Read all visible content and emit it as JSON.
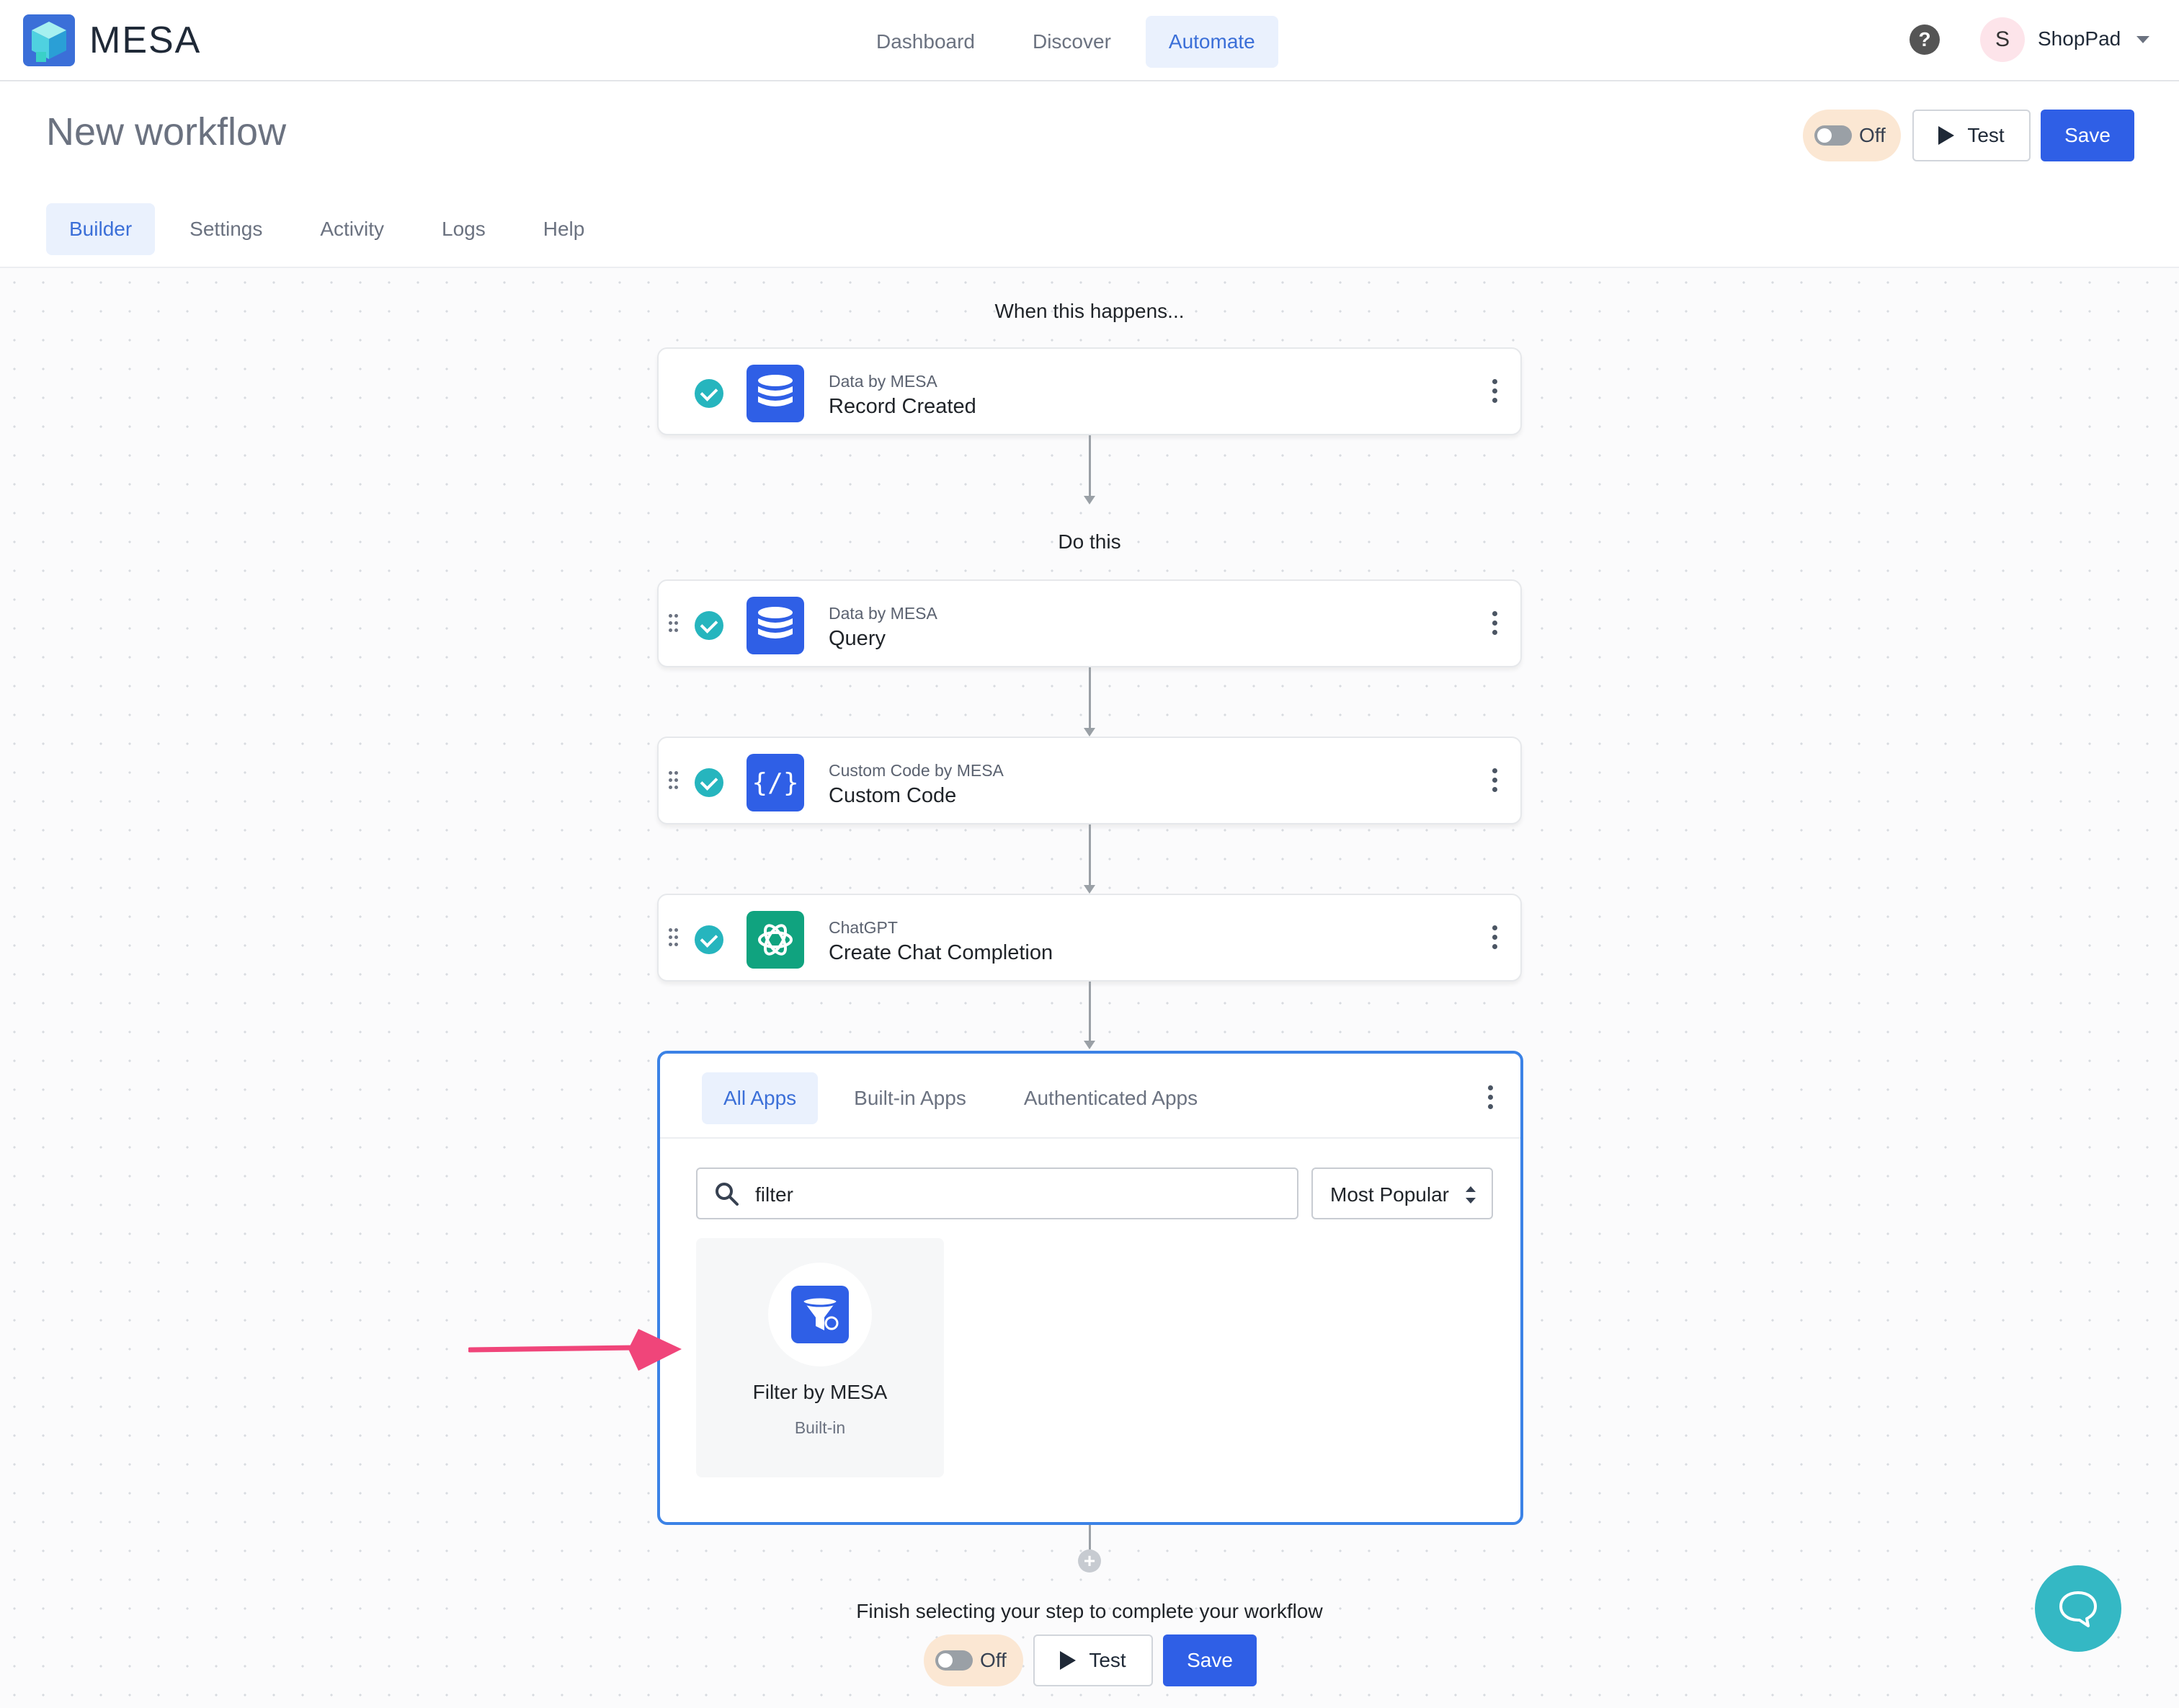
{
  "header": {
    "brand": "MESA",
    "nav": [
      {
        "label": "Dashboard",
        "active": false
      },
      {
        "label": "Discover",
        "active": false
      },
      {
        "label": "Automate",
        "active": true
      }
    ],
    "help_icon": "question-circle-icon",
    "user": {
      "initial": "S",
      "name": "ShopPad"
    }
  },
  "workflow": {
    "title": "New workflow",
    "toggle_label": "Off",
    "test_label": "Test",
    "save_label": "Save",
    "tabs": [
      {
        "label": "Builder",
        "active": true
      },
      {
        "label": "Settings",
        "active": false
      },
      {
        "label": "Activity",
        "active": false
      },
      {
        "label": "Logs",
        "active": false
      },
      {
        "label": "Help",
        "active": false
      }
    ]
  },
  "canvas": {
    "trigger_heading": "When this happens...",
    "action_heading": "Do this",
    "trigger": {
      "app": "Data by MESA",
      "action": "Record Created",
      "icon": "database-icon"
    },
    "steps": [
      {
        "app": "Data by MESA",
        "action": "Query",
        "icon": "database-icon"
      },
      {
        "app": "Custom Code by MESA",
        "action": "Custom Code",
        "icon": "code-braces-icon"
      },
      {
        "app": "ChatGPT",
        "action": "Create Chat Completion",
        "icon": "openai-icon"
      }
    ],
    "picker": {
      "tabs": [
        {
          "label": "All Apps",
          "active": true
        },
        {
          "label": "Built-in Apps",
          "active": false
        },
        {
          "label": "Authenticated Apps",
          "active": false
        }
      ],
      "search_value": "filter",
      "sort_value": "Most Popular",
      "results": [
        {
          "name": "Filter by MESA",
          "type": "Built-in",
          "icon": "filter-funnel-icon"
        }
      ]
    },
    "finish_message": "Finish selecting your step to complete your workflow",
    "bottom_toggle_label": "Off",
    "bottom_test_label": "Test",
    "bottom_save_label": "Save"
  },
  "colors": {
    "primary": "#2f5fe6",
    "accent_teal": "#26b5be",
    "chatgpt_green": "#10a37f",
    "annotation_arrow": "#f0457a",
    "toggle_bg": "#fbe7d3"
  }
}
